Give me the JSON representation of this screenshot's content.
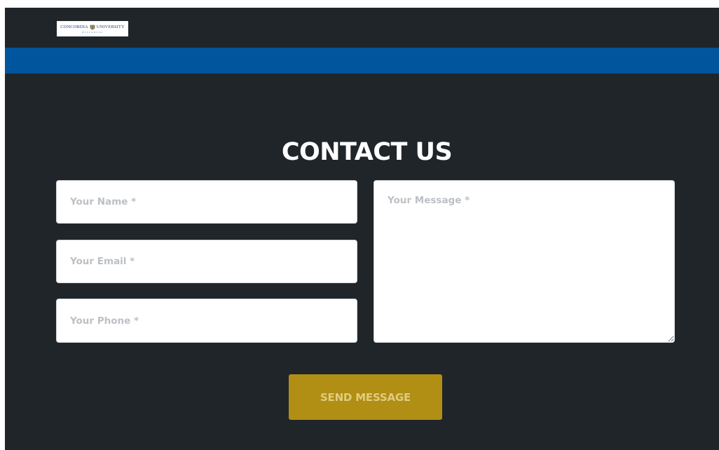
{
  "header": {
    "logo": {
      "main_text_left": "CONCORDIA",
      "main_text_right": "UNIVERSITY",
      "sub_text": "WISCONSIN",
      "icon": "seal-icon"
    }
  },
  "contact": {
    "title": "CONTACT US",
    "fields": {
      "name": {
        "placeholder": "Your Name *",
        "value": ""
      },
      "email": {
        "placeholder": "Your Email *",
        "value": ""
      },
      "phone": {
        "placeholder": "Your Phone *",
        "value": ""
      },
      "message": {
        "placeholder": "Your Message *",
        "value": ""
      }
    },
    "send_label": "SEND MESSAGE"
  },
  "colors": {
    "background": "#20252a",
    "brand_blue": "#00559c",
    "button_gold": "#b18e14",
    "button_text": "#e0cc7e",
    "placeholder": "#bcc0c5"
  }
}
